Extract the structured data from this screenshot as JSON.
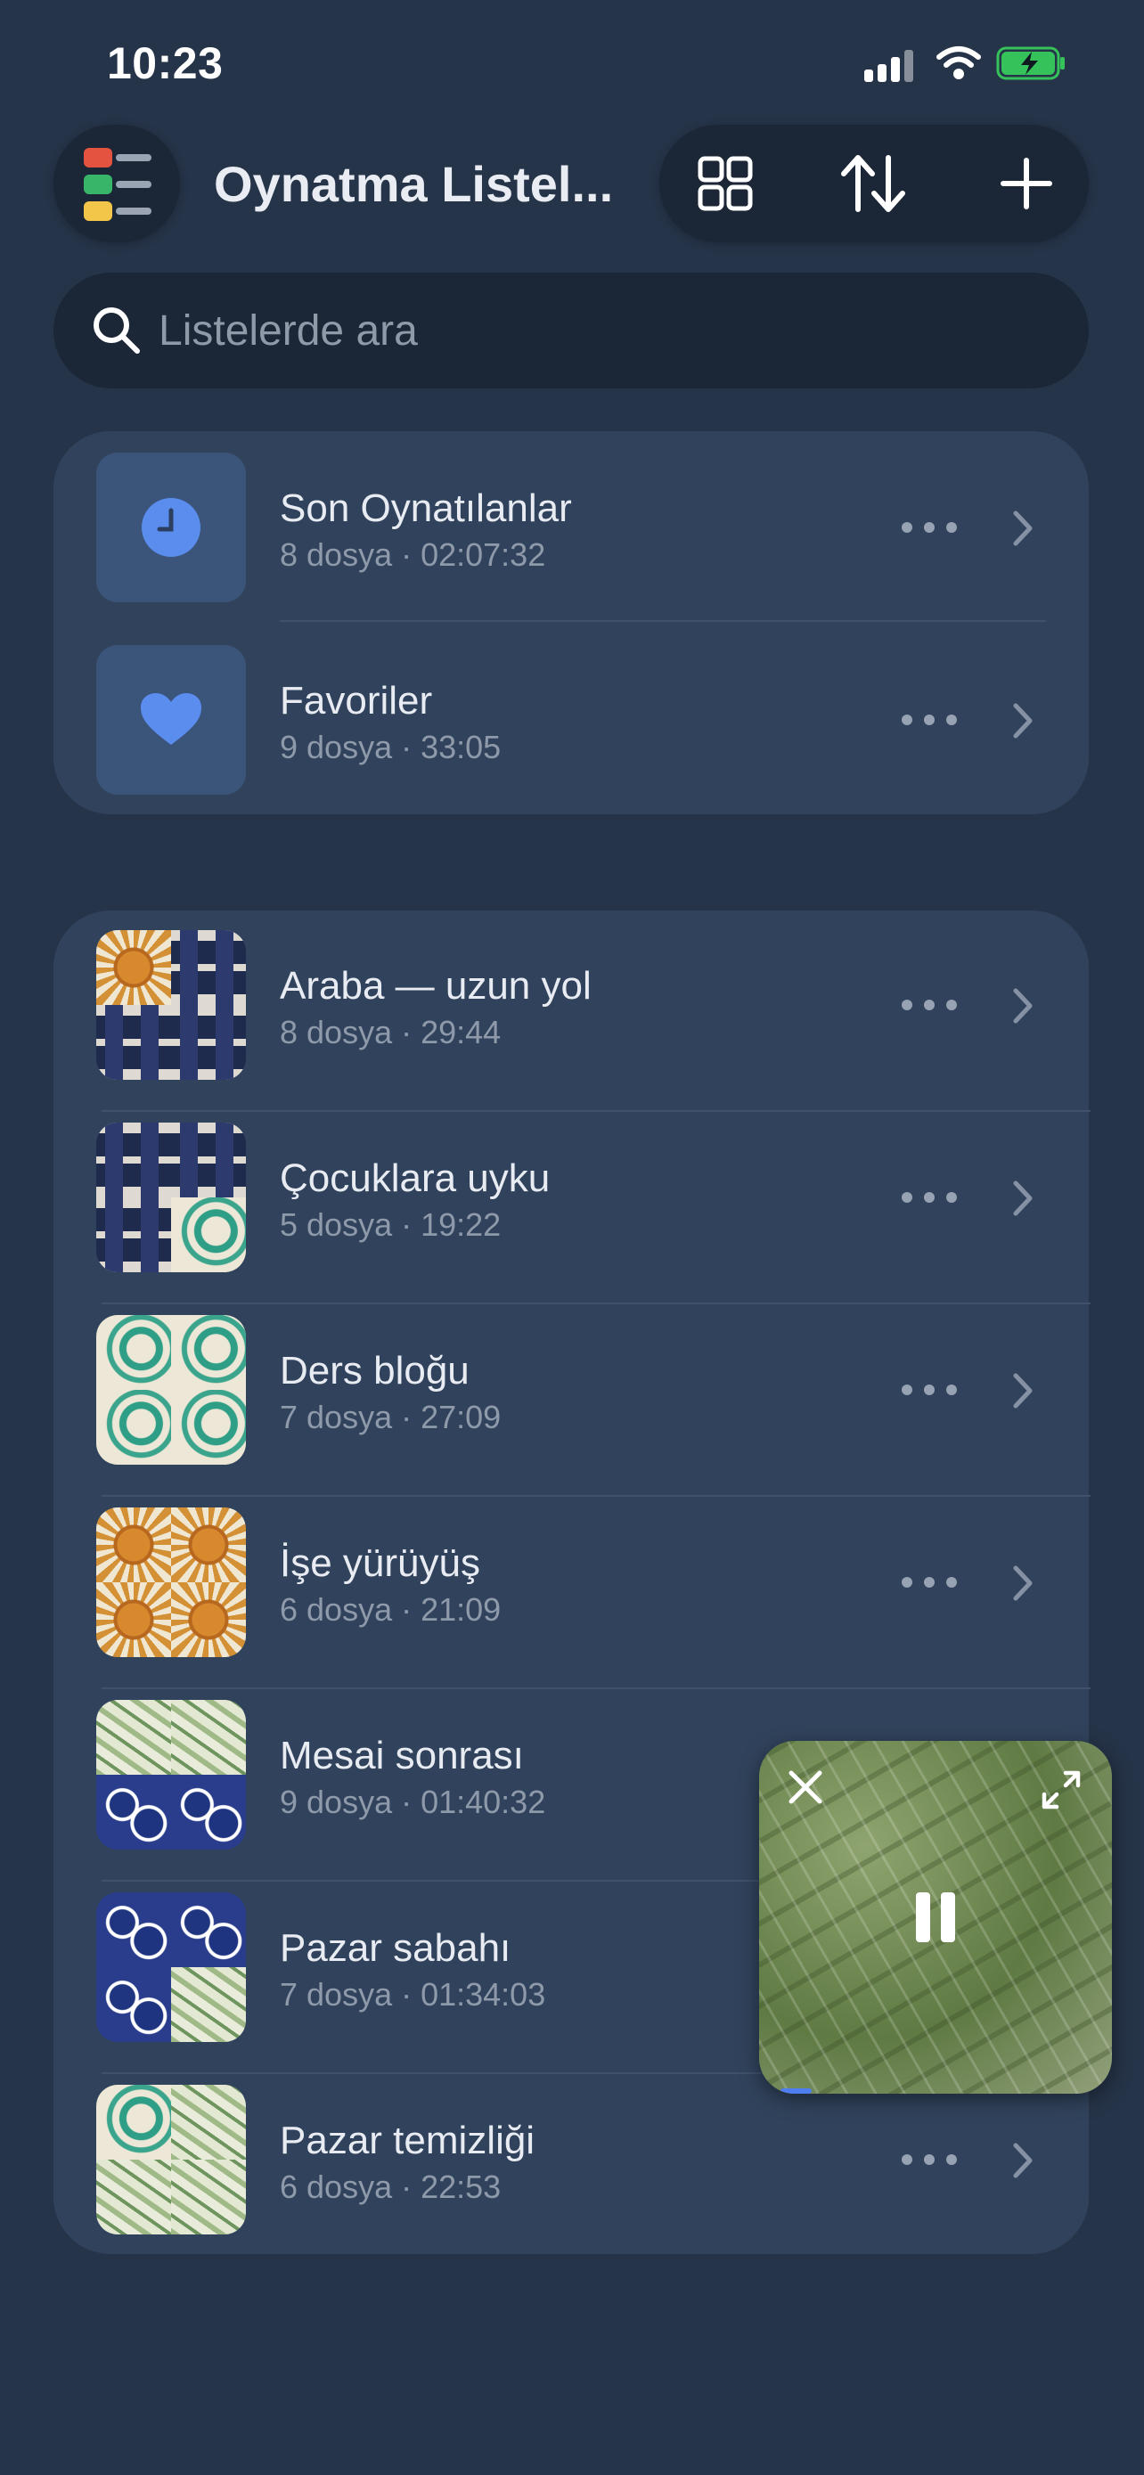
{
  "status_bar": {
    "time": "10:23"
  },
  "header": {
    "title": "Oynatma Listel..."
  },
  "search": {
    "placeholder": "Listelerde ara"
  },
  "system_lists": [
    {
      "name": "Son Oynatılanlar",
      "meta": "8 dosya · 02:07:32",
      "icon": "clock-icon"
    },
    {
      "name": "Favoriler",
      "meta": "9 dosya · 33:05",
      "icon": "heart-icon"
    }
  ],
  "playlists": [
    {
      "name": "Araba — uzun yol",
      "meta": "8 dosya · 29:44",
      "tiles": [
        "sun",
        "build",
        "build",
        "build"
      ]
    },
    {
      "name": "Çocuklara uyku",
      "meta": "5 dosya · 19:22",
      "tiles": [
        "build",
        "build",
        "build",
        "wave"
      ]
    },
    {
      "name": "Ders bloğu",
      "meta": "7 dosya · 27:09",
      "tiles": [
        "wave",
        "wave",
        "wave",
        "wave"
      ]
    },
    {
      "name": "İşe yürüyüş",
      "meta": "6 dosya · 21:09",
      "tiles": [
        "sun",
        "sun",
        "sun",
        "sun"
      ]
    },
    {
      "name": "Mesai sonrası",
      "meta": "9 dosya · 01:40:32",
      "tiles": [
        "leaf",
        "leaf",
        "drop",
        "drop"
      ]
    },
    {
      "name": "Pazar sabahı",
      "meta": "7 dosya · 01:34:03",
      "tiles": [
        "drop",
        "drop",
        "drop",
        "leaf"
      ]
    },
    {
      "name": "Pazar temizliği",
      "meta": "6 dosya · 22:53",
      "tiles": [
        "wave",
        "leaf",
        "leaf",
        "leaf"
      ]
    }
  ],
  "mini_player": {
    "state": "playing",
    "progress": 0.1
  },
  "colors": {
    "background": "#263449",
    "card": "#31435c",
    "accent": "#5b8def"
  }
}
